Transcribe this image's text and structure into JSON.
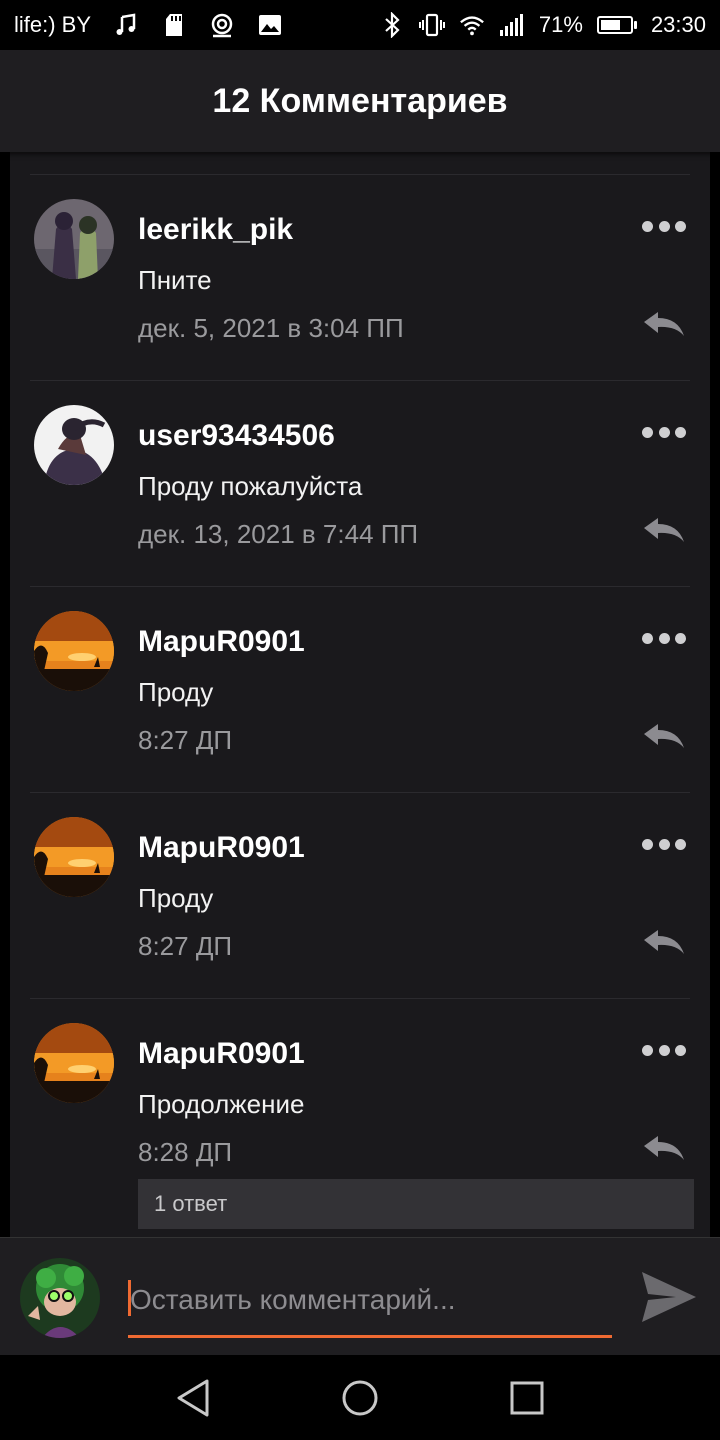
{
  "status_bar": {
    "carrier": "life:) BY",
    "battery": "71%",
    "battery_level": 0.71,
    "time": "23:30",
    "icons": [
      "music-icon",
      "sd-card-icon",
      "broadcast-icon",
      "image-icon",
      "bluetooth-icon",
      "vibrate-icon",
      "wifi-icon",
      "signal-icon",
      "battery-icon"
    ]
  },
  "header": {
    "title": "12 Комментариев"
  },
  "comments": [
    {
      "username": "leerikk_pik",
      "text": "Пните",
      "date": "дек. 5, 2021 в 3:04 ПП"
    },
    {
      "username": "user93434506",
      "text": "Проду пожалуйста",
      "date": "дек. 13, 2021 в 7:44 ПП"
    },
    {
      "username": "MapuR0901",
      "text": "Проду",
      "date": "8:27 ДП"
    },
    {
      "username": "MapuR0901",
      "text": "Проду",
      "date": "8:27 ДП"
    },
    {
      "username": "MapuR0901",
      "text": "Продолжение",
      "date": "8:28 ДП",
      "replies_label": "1 ответ"
    }
  ],
  "composer": {
    "placeholder": "Оставить комментарий..."
  },
  "colors": {
    "accent": "#ef6a32",
    "background": "#1a191c",
    "header": "#1f1e21"
  }
}
